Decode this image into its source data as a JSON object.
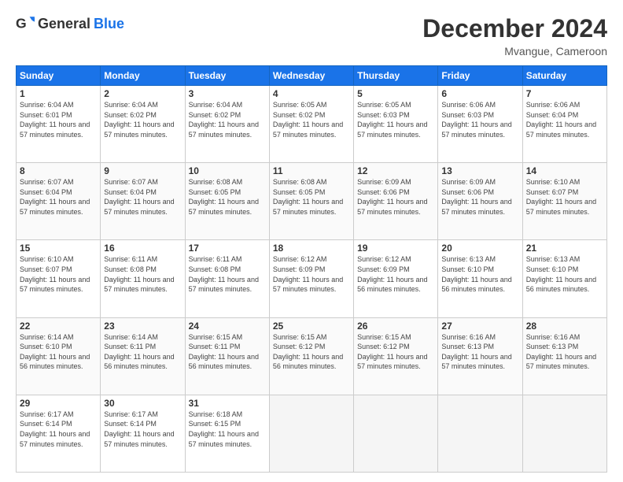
{
  "header": {
    "logo_general": "General",
    "logo_blue": "Blue",
    "title": "December 2024",
    "location": "Mvangue, Cameroon"
  },
  "calendar": {
    "days_of_week": [
      "Sunday",
      "Monday",
      "Tuesday",
      "Wednesday",
      "Thursday",
      "Friday",
      "Saturday"
    ],
    "weeks": [
      [
        {
          "day": 1,
          "sunrise": "6:04 AM",
          "sunset": "6:01 PM",
          "daylight": "11 hours and 57 minutes"
        },
        {
          "day": 2,
          "sunrise": "6:04 AM",
          "sunset": "6:02 PM",
          "daylight": "11 hours and 57 minutes"
        },
        {
          "day": 3,
          "sunrise": "6:04 AM",
          "sunset": "6:02 PM",
          "daylight": "11 hours and 57 minutes"
        },
        {
          "day": 4,
          "sunrise": "6:05 AM",
          "sunset": "6:02 PM",
          "daylight": "11 hours and 57 minutes"
        },
        {
          "day": 5,
          "sunrise": "6:05 AM",
          "sunset": "6:03 PM",
          "daylight": "11 hours and 57 minutes"
        },
        {
          "day": 6,
          "sunrise": "6:06 AM",
          "sunset": "6:03 PM",
          "daylight": "11 hours and 57 minutes"
        },
        {
          "day": 7,
          "sunrise": "6:06 AM",
          "sunset": "6:04 PM",
          "daylight": "11 hours and 57 minutes"
        }
      ],
      [
        {
          "day": 8,
          "sunrise": "6:07 AM",
          "sunset": "6:04 PM",
          "daylight": "11 hours and 57 minutes"
        },
        {
          "day": 9,
          "sunrise": "6:07 AM",
          "sunset": "6:04 PM",
          "daylight": "11 hours and 57 minutes"
        },
        {
          "day": 10,
          "sunrise": "6:08 AM",
          "sunset": "6:05 PM",
          "daylight": "11 hours and 57 minutes"
        },
        {
          "day": 11,
          "sunrise": "6:08 AM",
          "sunset": "6:05 PM",
          "daylight": "11 hours and 57 minutes"
        },
        {
          "day": 12,
          "sunrise": "6:09 AM",
          "sunset": "6:06 PM",
          "daylight": "11 hours and 57 minutes"
        },
        {
          "day": 13,
          "sunrise": "6:09 AM",
          "sunset": "6:06 PM",
          "daylight": "11 hours and 57 minutes"
        },
        {
          "day": 14,
          "sunrise": "6:10 AM",
          "sunset": "6:07 PM",
          "daylight": "11 hours and 57 minutes"
        }
      ],
      [
        {
          "day": 15,
          "sunrise": "6:10 AM",
          "sunset": "6:07 PM",
          "daylight": "11 hours and 57 minutes"
        },
        {
          "day": 16,
          "sunrise": "6:11 AM",
          "sunset": "6:08 PM",
          "daylight": "11 hours and 57 minutes"
        },
        {
          "day": 17,
          "sunrise": "6:11 AM",
          "sunset": "6:08 PM",
          "daylight": "11 hours and 57 minutes"
        },
        {
          "day": 18,
          "sunrise": "6:12 AM",
          "sunset": "6:09 PM",
          "daylight": "11 hours and 57 minutes"
        },
        {
          "day": 19,
          "sunrise": "6:12 AM",
          "sunset": "6:09 PM",
          "daylight": "11 hours and 56 minutes"
        },
        {
          "day": 20,
          "sunrise": "6:13 AM",
          "sunset": "6:10 PM",
          "daylight": "11 hours and 56 minutes"
        },
        {
          "day": 21,
          "sunrise": "6:13 AM",
          "sunset": "6:10 PM",
          "daylight": "11 hours and 56 minutes"
        }
      ],
      [
        {
          "day": 22,
          "sunrise": "6:14 AM",
          "sunset": "6:10 PM",
          "daylight": "11 hours and 56 minutes"
        },
        {
          "day": 23,
          "sunrise": "6:14 AM",
          "sunset": "6:11 PM",
          "daylight": "11 hours and 56 minutes"
        },
        {
          "day": 24,
          "sunrise": "6:15 AM",
          "sunset": "6:11 PM",
          "daylight": "11 hours and 56 minutes"
        },
        {
          "day": 25,
          "sunrise": "6:15 AM",
          "sunset": "6:12 PM",
          "daylight": "11 hours and 56 minutes"
        },
        {
          "day": 26,
          "sunrise": "6:15 AM",
          "sunset": "6:12 PM",
          "daylight": "11 hours and 57 minutes"
        },
        {
          "day": 27,
          "sunrise": "6:16 AM",
          "sunset": "6:13 PM",
          "daylight": "11 hours and 57 minutes"
        },
        {
          "day": 28,
          "sunrise": "6:16 AM",
          "sunset": "6:13 PM",
          "daylight": "11 hours and 57 minutes"
        }
      ],
      [
        {
          "day": 29,
          "sunrise": "6:17 AM",
          "sunset": "6:14 PM",
          "daylight": "11 hours and 57 minutes"
        },
        {
          "day": 30,
          "sunrise": "6:17 AM",
          "sunset": "6:14 PM",
          "daylight": "11 hours and 57 minutes"
        },
        {
          "day": 31,
          "sunrise": "6:18 AM",
          "sunset": "6:15 PM",
          "daylight": "11 hours and 57 minutes"
        },
        null,
        null,
        null,
        null
      ]
    ]
  }
}
